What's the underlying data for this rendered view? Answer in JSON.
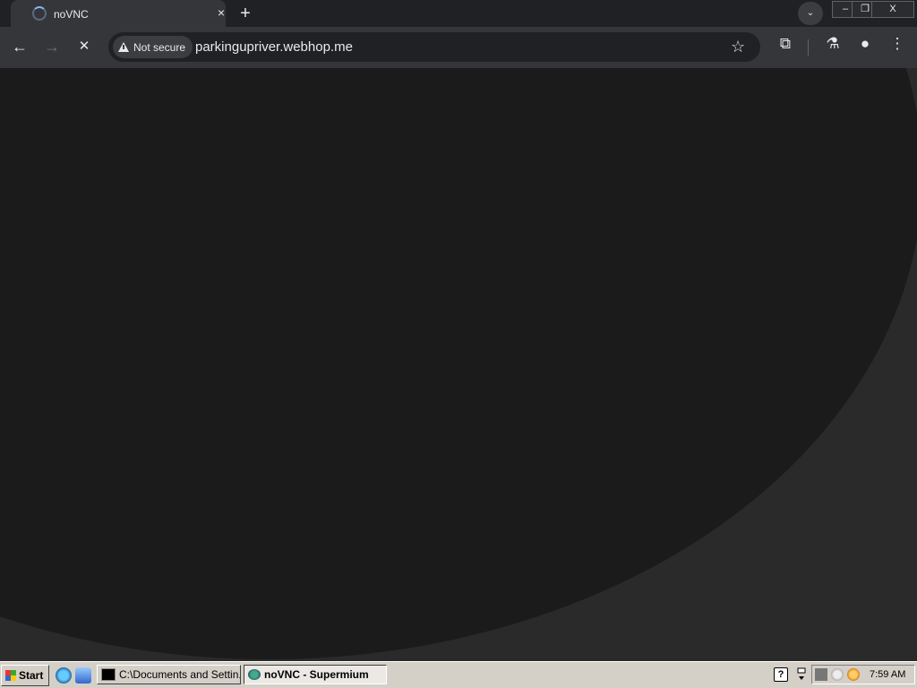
{
  "browser": {
    "tab": {
      "title": "noVNC",
      "close_label": "×"
    },
    "new_tab_label": "+",
    "tab_search_label": "⌄",
    "window_controls": {
      "minimize": "–",
      "restore": "❐",
      "close": "X"
    },
    "nav": {
      "back": "←",
      "forward": "→",
      "stop": "✕"
    },
    "omnibox": {
      "security_label": "Not secure",
      "url": "parkingupriver.webhop.me"
    },
    "bookmark_icon": "☆",
    "toolbar_icons": {
      "extensions": "⧉",
      "labs": "⚗",
      "profile": "●",
      "menu": "⋮"
    }
  },
  "page": {
    "tiny_text": "· · ·"
  },
  "taskbar": {
    "start_label": "Start",
    "items": [
      {
        "label": "C:\\Documents and Settin...",
        "active": false
      },
      {
        "label": "noVNC - Supermium",
        "active": true
      }
    ],
    "clock": "7:59 AM",
    "help_icon": "?"
  },
  "colors": {
    "page_dark": "#1b1b1b",
    "page_light": "#2a2a2a",
    "chrome": "#35363a",
    "taskbar": "#d4d0c8"
  }
}
